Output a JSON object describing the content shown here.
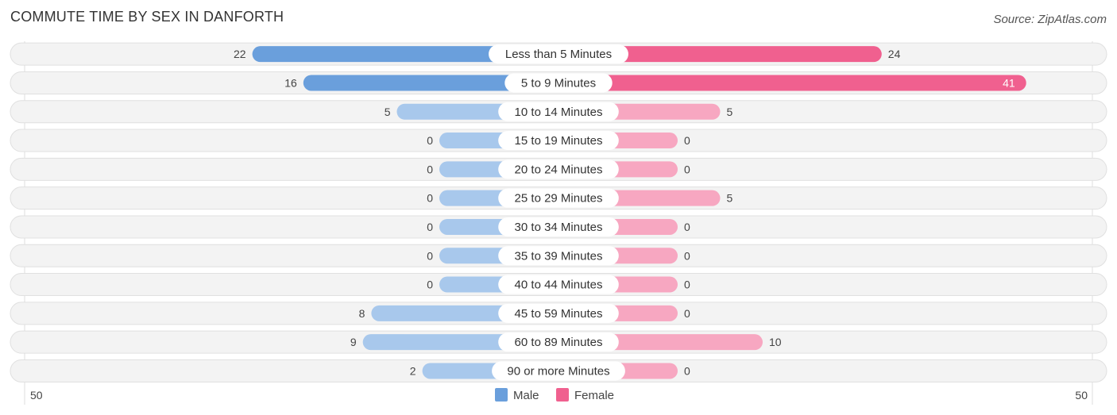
{
  "chart_data": {
    "type": "bar",
    "orientation": "horizontal-diverging",
    "title": "COMMUTE TIME BY SEX IN DANFORTH",
    "source": "Source: ZipAtlas.com",
    "categories": [
      "Less than 5 Minutes",
      "5 to 9 Minutes",
      "10 to 14 Minutes",
      "15 to 19 Minutes",
      "20 to 24 Minutes",
      "25 to 29 Minutes",
      "30 to 34 Minutes",
      "35 to 39 Minutes",
      "40 to 44 Minutes",
      "45 to 59 Minutes",
      "60 to 89 Minutes",
      "90 or more Minutes"
    ],
    "series": [
      {
        "name": "Male",
        "color": "#6a9fdc",
        "values": [
          22,
          16,
          5,
          0,
          0,
          0,
          0,
          0,
          0,
          8,
          9,
          2
        ]
      },
      {
        "name": "Female",
        "color": "#f0608f",
        "values": [
          24,
          41,
          5,
          0,
          0,
          5,
          0,
          0,
          0,
          0,
          10,
          0
        ]
      }
    ],
    "axis": {
      "left_label": "50",
      "right_label": "50",
      "max": 50
    },
    "legend": {
      "position": "bottom-center",
      "items": [
        "Male",
        "Female"
      ]
    }
  }
}
